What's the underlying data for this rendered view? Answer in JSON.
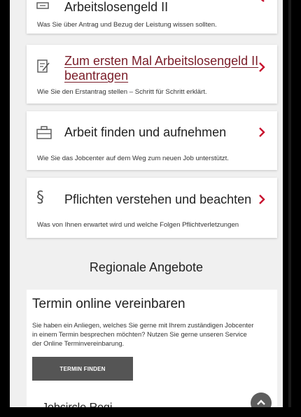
{
  "cards": [
    {
      "title": "Arbeitslosengeld II",
      "desc": "Was Sie über Antrag und Bezug der Leistung wissen sollten.",
      "icon": "money-icon"
    },
    {
      "title_line1": "Zum ersten Mal Arbeitslosengeld II",
      "title_line2": "beantragen",
      "desc": "Wie Sie den Erstantrag stellen – Schritt für Schritt erklärt.",
      "icon": "form-icon"
    },
    {
      "title": "Arbeit finden und aufnehmen",
      "desc": "Wie Sie das Jobcenter auf dem Weg zum neuen Job unterstützt.",
      "icon": "briefcase-icon"
    },
    {
      "title": "Pflichten verstehen und beachten",
      "desc": "Was von Ihnen erwartet wird und welche Folgen Pflichtverletzungen",
      "icon": "paragraph-icon",
      "icon_glyph": "§"
    }
  ],
  "section": {
    "title": "Regionale Angebote"
  },
  "termin": {
    "heading": "Termin online vereinbaren",
    "text": "Sie haben ein Anliegen, welches Sie gerne mit Ihrem zuständigen Jobcenter in einem Termin besprechen möchten? Nutzen Sie gerne unseren Service der Online Terminvereinbarung.",
    "button": "TERMIN FINDEN",
    "next_heading_partial": "Jobcircle  Regi..."
  },
  "colors": {
    "accent": "#7a1c28",
    "chevron": "#c8102e",
    "button": "#555555",
    "background": "#f0f0f0"
  }
}
